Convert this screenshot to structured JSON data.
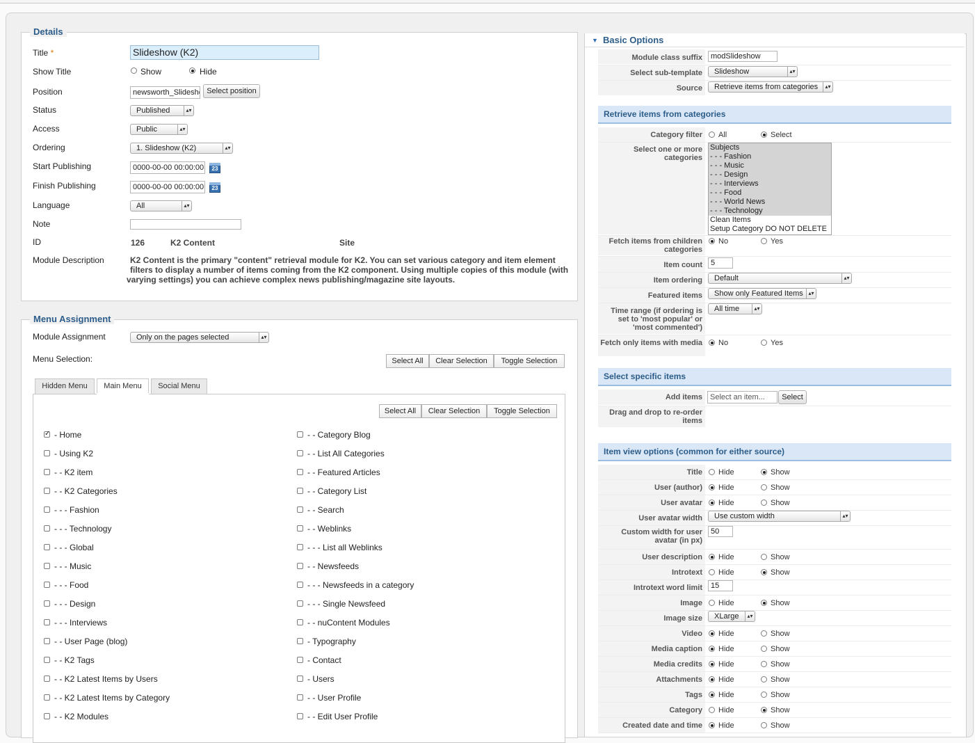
{
  "details": {
    "legend": "Details",
    "title_label": "Title",
    "title_required": "*",
    "title_value": "Slideshow (K2)",
    "show_title_label": "Show Title",
    "show_option": "Show",
    "hide_option": "Hide",
    "position_label": "Position",
    "position_value": "newsworth_Slideshow",
    "select_position_button": "Select position",
    "status_label": "Status",
    "status_value": "Published",
    "access_label": "Access",
    "access_value": "Public",
    "ordering_label": "Ordering",
    "ordering_value": "1. Slideshow (K2)",
    "start_publishing_label": "Start Publishing",
    "start_publishing_value": "0000-00-00 00:00:00",
    "finish_publishing_label": "Finish Publishing",
    "finish_publishing_value": "0000-00-00 00:00:00",
    "calendar_glyph": "23",
    "language_label": "Language",
    "language_value": "All",
    "note_label": "Note",
    "note_value": "",
    "id_label": "ID",
    "id_value": "126",
    "module_name": "K2 Content",
    "client": "Site",
    "module_description_label": "Module Description",
    "module_description_line1": "K2 Content is the primary \"content\" retrieval module for K2. You can set various category and item element",
    "module_description_line2": "filters to display a number of items coming from the K2 component. Using multiple copies of this module (with",
    "module_description_line3": "varying settings) you can achieve complex news publishing/magazine site layouts."
  },
  "menu_assignment": {
    "legend": "Menu Assignment",
    "module_assignment_label": "Module Assignment",
    "module_assignment_value": "Only on the pages selected",
    "menu_selection_label": "Menu Selection:",
    "select_all": "Select All",
    "clear_selection": "Clear Selection",
    "toggle_selection": "Toggle Selection",
    "tabs": [
      "Hidden Menu",
      "Main Menu",
      "Social Menu"
    ],
    "active_tab": "Main Menu",
    "left_items": [
      {
        "label": "- Home",
        "checked": true
      },
      {
        "label": "- Using K2",
        "checked": false
      },
      {
        "label": "- - K2 item",
        "checked": false
      },
      {
        "label": "- - K2 Categories",
        "checked": false
      },
      {
        "label": "- - - Fashion",
        "checked": false
      },
      {
        "label": "- - - Technology",
        "checked": false
      },
      {
        "label": "- - - Global",
        "checked": false
      },
      {
        "label": "- - - Music",
        "checked": false
      },
      {
        "label": "- - - Food",
        "checked": false
      },
      {
        "label": "- - - Design",
        "checked": false
      },
      {
        "label": "- - - Interviews",
        "checked": false
      },
      {
        "label": "- - User Page (blog)",
        "checked": false
      },
      {
        "label": "- - K2 Tags",
        "checked": false
      },
      {
        "label": "- - K2 Latest Items by Users",
        "checked": false
      },
      {
        "label": "- - K2 Latest Items by Category",
        "checked": false
      },
      {
        "label": "- - K2 Modules",
        "checked": false
      }
    ],
    "right_items": [
      {
        "label": "- - Category Blog",
        "checked": false
      },
      {
        "label": "- - List All Categories",
        "checked": false
      },
      {
        "label": "- - Featured Articles",
        "checked": false
      },
      {
        "label": "- - Category List",
        "checked": false
      },
      {
        "label": "- - Search",
        "checked": false
      },
      {
        "label": "- - Weblinks",
        "checked": false
      },
      {
        "label": "- - - List all Weblinks",
        "checked": false
      },
      {
        "label": "- - Newsfeeds",
        "checked": false
      },
      {
        "label": "- - - Newsfeeds in a category",
        "checked": false
      },
      {
        "label": "- - - Single Newsfeed",
        "checked": false
      },
      {
        "label": "- - nuContent Modules",
        "checked": false
      },
      {
        "label": "- Typography",
        "checked": false
      },
      {
        "label": "- Contact",
        "checked": false
      },
      {
        "label": "- Users",
        "checked": false
      },
      {
        "label": "- - User Profile",
        "checked": false
      },
      {
        "label": "- - Edit User Profile",
        "checked": false
      }
    ]
  },
  "basic_options": {
    "header": "Basic Options",
    "module_class_suffix_label": "Module class suffix",
    "module_class_suffix_value": "modSlideshow",
    "sub_template_label": "Select sub-template",
    "sub_template_value": "Slideshow",
    "source_label": "Source",
    "source_value": "Retrieve items from categories",
    "retrieve_section": "Retrieve items from categories",
    "category_filter_label": "Category filter",
    "all_option": "All",
    "select_option": "Select",
    "categories_label": "Select one or more categories",
    "categories": [
      {
        "label": "Subjects",
        "selected": true
      },
      {
        "label": "- - - Fashion",
        "selected": true
      },
      {
        "label": "- - - Music",
        "selected": true
      },
      {
        "label": "- - - Design",
        "selected": true
      },
      {
        "label": "- - - Interviews",
        "selected": true
      },
      {
        "label": "- - - Food",
        "selected": true
      },
      {
        "label": "- - - World News",
        "selected": true
      },
      {
        "label": "- - - Technology",
        "selected": true
      },
      {
        "label": "Clean Items",
        "selected": false
      },
      {
        "label": "Setup Category DO NOT DELETE",
        "selected": false
      }
    ],
    "fetch_children_label": "Fetch items from children categories",
    "no_option": "No",
    "yes_option": "Yes",
    "item_count_label": "Item count",
    "item_count_value": "5",
    "item_ordering_label": "Item ordering",
    "item_ordering_value": "Default",
    "featured_items_label": "Featured items",
    "featured_items_value": "Show only Featured Items",
    "time_range_label": "Time range (if ordering is set to 'most popular' or 'most commented')",
    "time_range_value": "All time",
    "fetch_media_label": "Fetch only items with media",
    "specific_section": "Select specific items",
    "add_items_label": "Add items",
    "add_items_placeholder": "Select an item...",
    "select_button": "Select",
    "drag_label": "Drag and drop to re-order items",
    "view_section": "Item view options (common for either source)",
    "hide_option": "Hide",
    "show_option": "Show",
    "title_label": "Title",
    "user_author_label": "User (author)",
    "user_avatar_label": "User avatar",
    "avatar_width_label": "User avatar width",
    "avatar_width_value": "Use custom width",
    "custom_width_label": "Custom width for user avatar (in px)",
    "custom_width_value": "50",
    "user_description_label": "User description",
    "introtext_label": "Introtext",
    "introtext_limit_label": "Introtext word limit",
    "introtext_limit_value": "15",
    "image_label": "Image",
    "image_size_label": "Image size",
    "image_size_value": "XLarge",
    "video_label": "Video",
    "media_caption_label": "Media caption",
    "media_credits_label": "Media credits",
    "attachments_label": "Attachments",
    "tags_label": "Tags",
    "category_label": "Category",
    "created_date_label": "Created date and time"
  }
}
